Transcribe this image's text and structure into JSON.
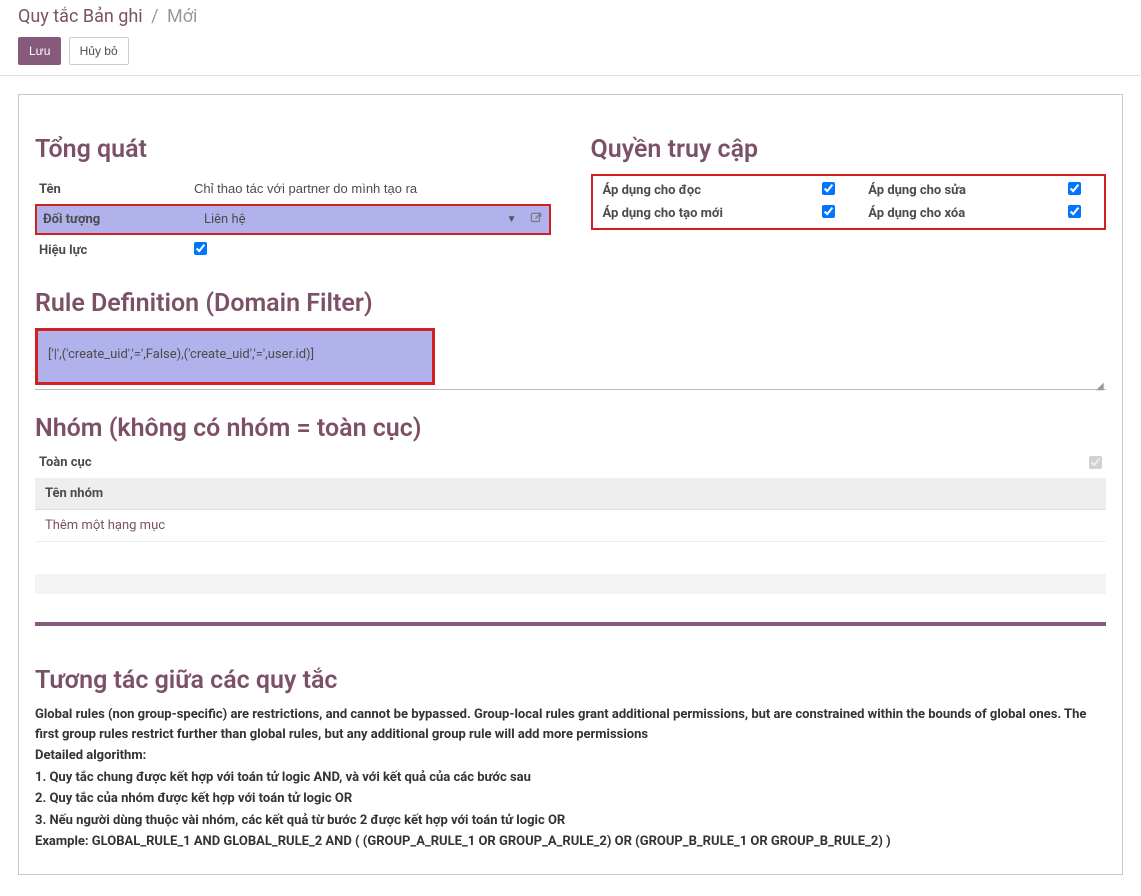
{
  "breadcrumb": {
    "root": "Quy tắc Bản ghi",
    "sep": "/",
    "current": "Mới"
  },
  "buttons": {
    "save": "Lưu",
    "discard": "Hủy bỏ"
  },
  "section_general": "Tổng quát",
  "field_name_label": "Tên",
  "field_name_value": "Chỉ thao tác với partner do mình tạo ra",
  "field_object_label": "Đối tượng",
  "field_object_value": "Liên hệ",
  "field_active_label": "Hiệu lực",
  "section_access": "Quyền truy cập",
  "perms": {
    "read": {
      "label": "Áp dụng cho đọc",
      "checked": true
    },
    "write": {
      "label": "Áp dụng cho sửa",
      "checked": true
    },
    "create": {
      "label": "Áp dụng cho tạo mới",
      "checked": true
    },
    "unlink": {
      "label": "Áp dụng cho xóa",
      "checked": true
    }
  },
  "section_rule": "Rule Definition (Domain Filter)",
  "domain_value": "['|',('create_uid','=',False),('create_uid','=',user.id)]",
  "section_groups": "Nhóm (không có nhóm = toàn cục)",
  "global_label": "Toàn cục",
  "group_col_header": "Tên nhóm",
  "add_item": "Thêm một hạng mục",
  "section_interaction": "Tương tác giữa các quy tắc",
  "info": {
    "l1": "Global rules (non group-specific) are restrictions, and cannot be bypassed. Group-local rules grant additional permissions, but are constrained within the bounds of global ones. The first group rules restrict further than global rules, but any additional group rule will add more permissions",
    "l2": "Detailed algorithm:",
    "l3": "1. Quy tắc chung được kết hợp với toán tử logic AND, và với kết quả của các bước sau",
    "l4": "2. Quy tắc của nhóm được kết hợp với toán tử logic OR",
    "l5": "3. Nếu người dùng thuộc vài nhóm, các kết quả từ bước 2 được kết hợp với toán tử logic OR",
    "l6": "Example: GLOBAL_RULE_1 AND GLOBAL_RULE_2 AND ( (GROUP_A_RULE_1 OR GROUP_A_RULE_2) OR (GROUP_B_RULE_1 OR GROUP_B_RULE_2) )"
  }
}
